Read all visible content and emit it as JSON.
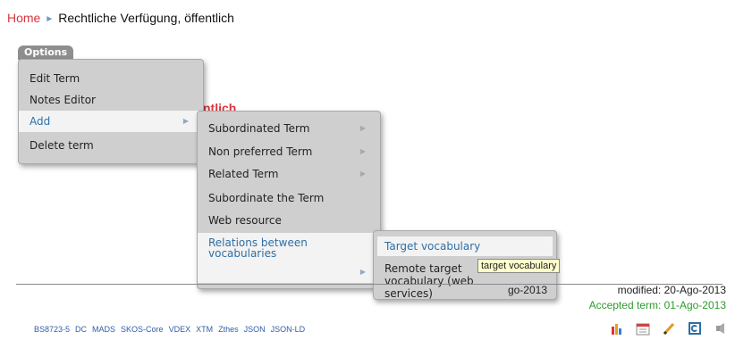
{
  "breadcrumb": {
    "home": "Home",
    "separator": "►",
    "current": "Rechtliche Verfügung, öffentlich"
  },
  "options_button": "Options",
  "behind_title_fragment": "ntlich",
  "menu_level1": [
    {
      "label": "Edit Term"
    },
    {
      "label": "Notes Editor"
    },
    {
      "label": "Add",
      "has_submenu": true,
      "active": true
    },
    {
      "label": "Delete term"
    }
  ],
  "menu_level2": [
    {
      "label": "Subordinated Term",
      "has_submenu": true
    },
    {
      "label": "Non preferred Term",
      "has_submenu": true
    },
    {
      "label": "Related Term",
      "has_submenu": true
    },
    {
      "label": "Subordinate the Term"
    },
    {
      "label": "Web resource"
    },
    {
      "label": "Relations between vocabularies",
      "has_submenu": true,
      "active": true
    }
  ],
  "menu_level3": [
    {
      "label": "Target vocabulary",
      "active": true
    },
    {
      "label": "Remote target vocabulary (web services)"
    }
  ],
  "tooltip": "target vocabulary",
  "dates": {
    "created_fragment": "go-2013",
    "modified": "modified: 20-Ago-2013",
    "accepted": "Accepted term: 01-Ago-2013"
  },
  "export_formats": [
    "BS8723-5",
    "DC",
    "MADS",
    "SKOS-Core",
    "VDEX",
    "XTM",
    "Zthes",
    "JSON",
    "JSON-LD"
  ],
  "footer_icons": [
    "chart-icon",
    "calendar-icon",
    "pencil-icon",
    "copy-icon",
    "sound-icon"
  ],
  "colors": {
    "home_link": "#d9363e",
    "accepted": "#2c9c2c",
    "menu_bg": "#cfcfcf",
    "active_item_text": "#2e6fa5"
  }
}
